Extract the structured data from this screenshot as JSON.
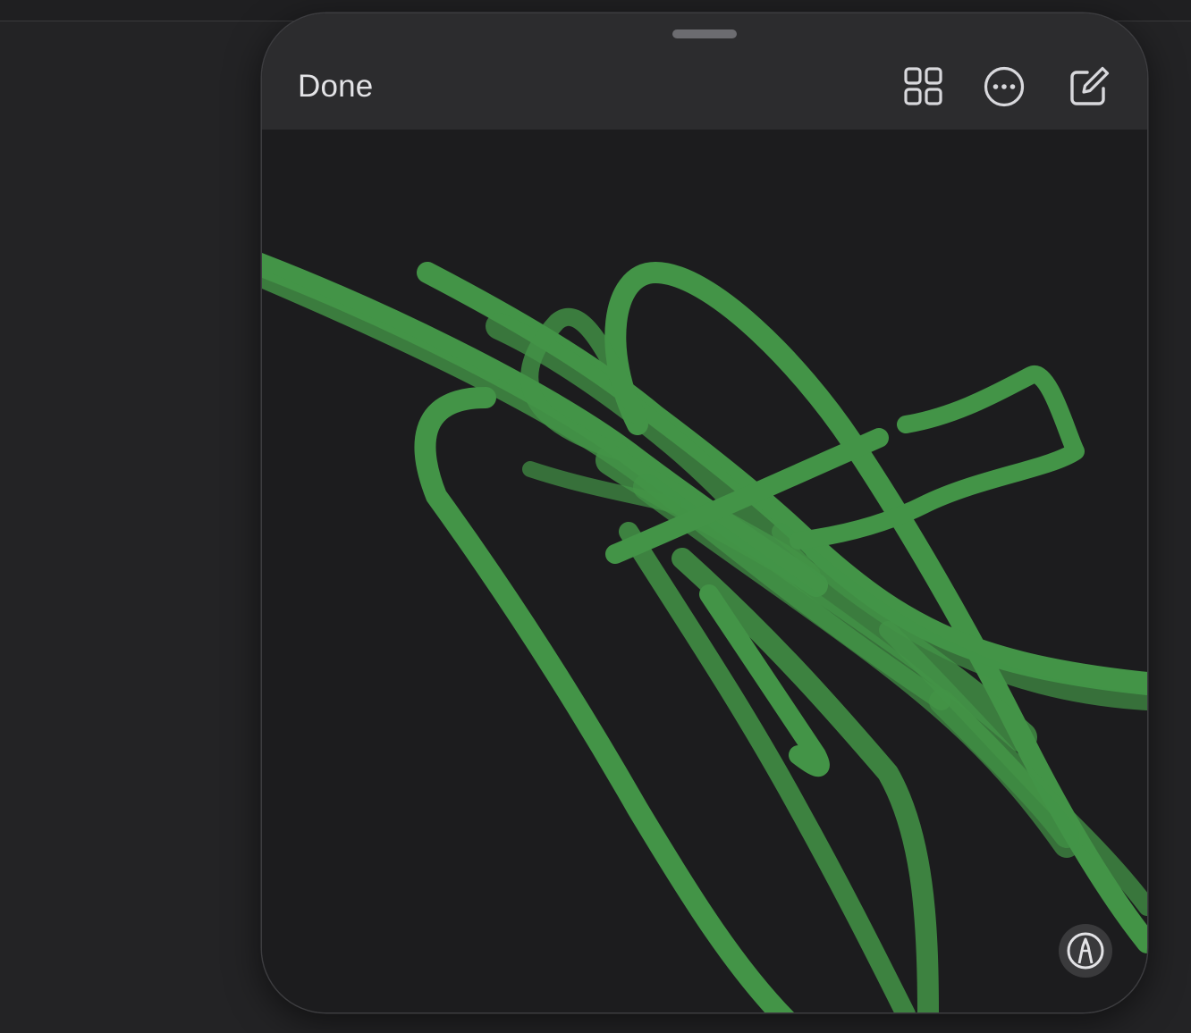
{
  "toolbar": {
    "done_label": "Done",
    "icons": {
      "grid": "grid-view-icon",
      "more": "more-options-icon",
      "compose": "compose-icon"
    }
  },
  "canvas": {
    "stroke_color": "#4caf50",
    "background_color": "#1c1c1e"
  },
  "markup": {
    "icon": "markup-pen-icon"
  },
  "colors": {
    "toolbar_bg": "#2c2c2e",
    "text": "#e3e3e6",
    "icon": "#d8d8dc"
  }
}
